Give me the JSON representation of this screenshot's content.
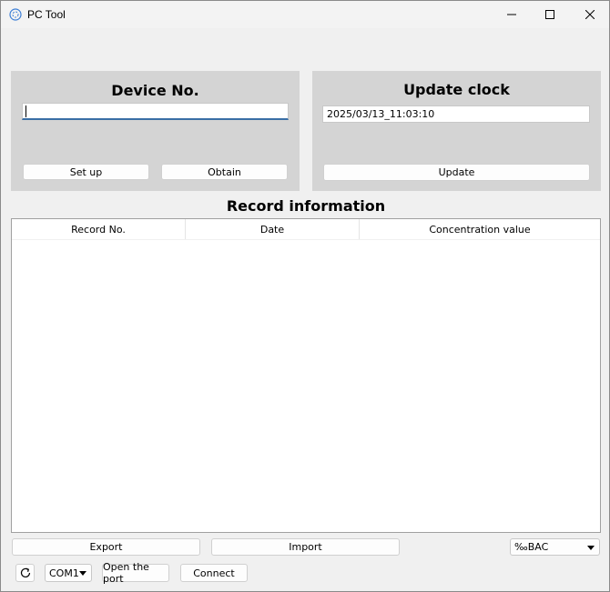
{
  "window": {
    "title": "PC Tool"
  },
  "device_panel": {
    "title": "Device No.",
    "input_value": "",
    "setup_label": "Set up",
    "obtain_label": "Obtain"
  },
  "clock_panel": {
    "title": "Update clock",
    "datetime_value": "2025/03/13_11:03:10",
    "update_label": "Update"
  },
  "records": {
    "title": "Record information",
    "columns": [
      "Record No.",
      "Date",
      "Concentration value"
    ],
    "rows": []
  },
  "actions": {
    "export_label": "Export",
    "import_label": "Import",
    "unit_selected": "‰BAC"
  },
  "port": {
    "com_selected": "COM1",
    "open_label": "Open the port",
    "connect_label": "Connect"
  },
  "icons": {
    "app": "app-logo-icon",
    "minimize": "minimize-icon",
    "maximize": "maximize-icon",
    "close": "close-icon",
    "refresh": "refresh-icon"
  },
  "colors": {
    "panel": "#d4d4d4",
    "focus_accent": "#3a6ea5"
  }
}
